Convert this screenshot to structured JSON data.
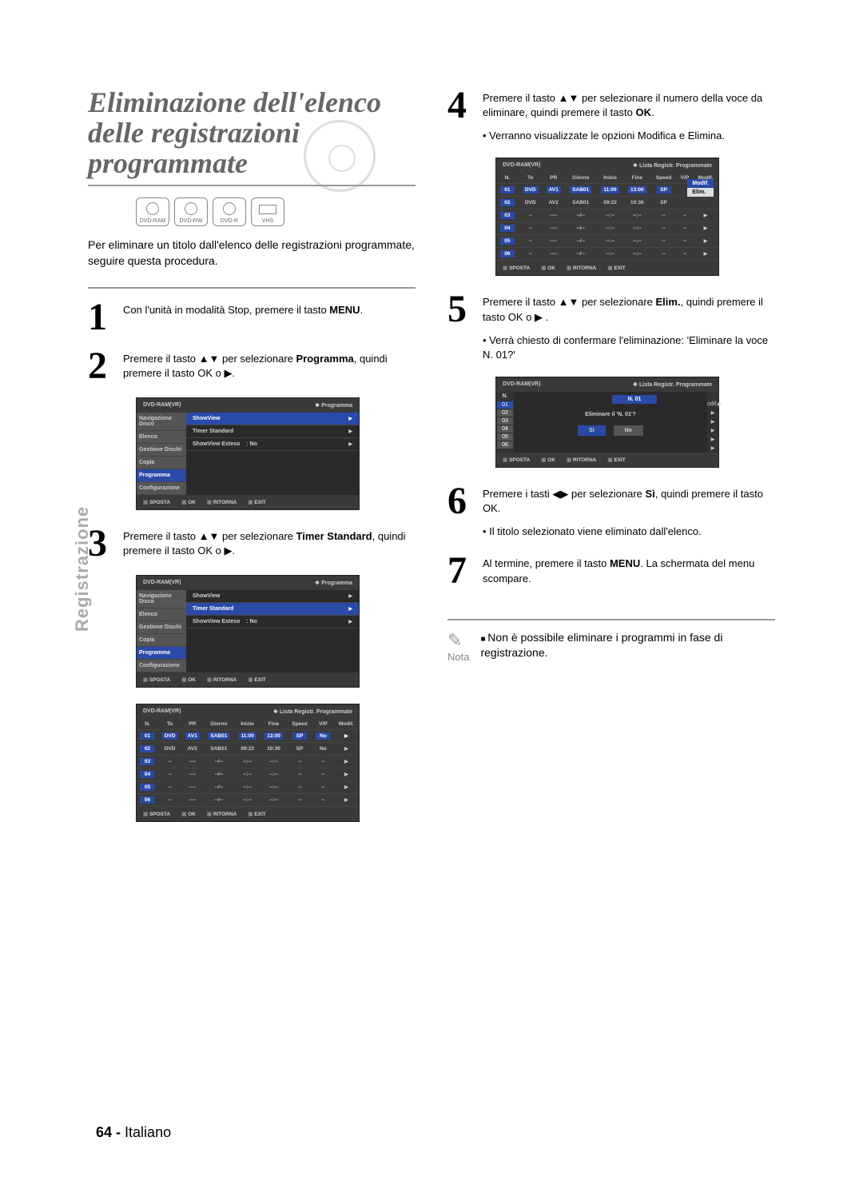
{
  "page": {
    "section_tab": "Registrazione",
    "title": "Eliminazione dell'elenco delle registrazioni programmate",
    "badges": [
      "DVD-RAM",
      "DVD-RW",
      "DVD-R",
      "VHS"
    ],
    "intro": "Per eliminare un titolo dall'elenco delle registrazioni programmate, seguire questa procedura.",
    "footer_num": "64 -",
    "footer_lang": "Italiano"
  },
  "steps": {
    "s1": {
      "num": "1",
      "pre": "Con l'unità in modalità Stop, premere il tasto ",
      "b": "MENU",
      "post": "."
    },
    "s2": {
      "num": "2",
      "pre": "Premere il tasto ▲▼ per selezionare ",
      "b": "Programma",
      "post": ", quindi premere il tasto OK o ▶."
    },
    "s3": {
      "num": "3",
      "pre": "Premere il tasto ▲▼ per selezionare ",
      "b": "Timer Standard",
      "post": ", quindi premere il tasto OK o ▶."
    },
    "s4": {
      "num": "4",
      "pre": "Premere il tasto ▲▼ per selezionare il numero della voce da eliminare, quindi premere il tasto ",
      "b": "OK",
      "post": "."
    },
    "s4b": "• Verranno visualizzate le opzioni Modifica e Elimina.",
    "s5": {
      "num": "5",
      "pre": "Premere il tasto ▲▼  per selezionare ",
      "b": "Elim.",
      "post": ", quindi premere il tasto OK o ▶ ."
    },
    "s5b": "• Verrà chiesto di confermare l'eliminazione: 'Eliminare la voce N. 01?'",
    "s6": {
      "num": "6",
      "pre": "Premere i tasti ◀▶ per selezionare ",
      "b": "Sì",
      "post": ", quindi premere il tasto OK."
    },
    "s6b": "• Il titolo selezionato viene eliminato dall'elenco.",
    "s7": {
      "num": "7",
      "pre": "Al termine, premere il tasto ",
      "b": "MENU",
      "post": ". La schermata del menu scompare."
    }
  },
  "note": {
    "label": "Nota",
    "text": "Non è possibile eliminare i programmi in fase di registrazione."
  },
  "osd": {
    "hdr_mode": "DVD-RAM(VR)",
    "hdr_prog": "Programma",
    "hdr_list": "Lista Registr. Programmate",
    "side": [
      "Navigazione Disco",
      "Elenco",
      "Gestione Dischi",
      "Copia",
      "Programma",
      "Configurazione"
    ],
    "menuA": [
      {
        "l": "ShowView",
        "v": ""
      },
      {
        "l": "Timer Standard",
        "v": ""
      },
      {
        "l": "ShowView Esteso",
        "v": ": No"
      }
    ],
    "ftr": [
      "SPOSTA",
      "OK",
      "RITORNA",
      "EXIT"
    ],
    "table_hdr": [
      "N.",
      "To",
      "PR",
      "Giorno",
      "Inizio",
      "Fine",
      "Speed",
      "V/P",
      "Modif."
    ],
    "rows_a": [
      [
        "01",
        "DVD",
        "AV1",
        "SAB01",
        "11:00",
        "13:00",
        "SP",
        "No",
        "▶"
      ],
      [
        "02",
        "DVD",
        "AV2",
        "SAB01",
        "09:22",
        "10:30",
        "SP",
        "No",
        "▶"
      ],
      [
        "03",
        "--",
        "----",
        "--/--",
        "--:--",
        "--:--",
        "--",
        "--",
        "▶"
      ],
      [
        "04",
        "--",
        "----",
        "--/--",
        "--:--",
        "--:--",
        "--",
        "--",
        "▶"
      ],
      [
        "05",
        "--",
        "----",
        "--/--",
        "--:--",
        "--:--",
        "--",
        "--",
        "▶"
      ],
      [
        "06",
        "--",
        "----",
        "--/--",
        "--:--",
        "--:--",
        "--",
        "--",
        "▶"
      ]
    ],
    "popup": [
      "Modif.",
      "Elim."
    ],
    "dialog": {
      "title": "N. 01",
      "q": "Eliminare il 'N. 01'?",
      "yes": "Sì",
      "no": "No"
    },
    "dialog_side": [
      "01",
      "02",
      "03",
      "04",
      "05",
      "06"
    ]
  }
}
